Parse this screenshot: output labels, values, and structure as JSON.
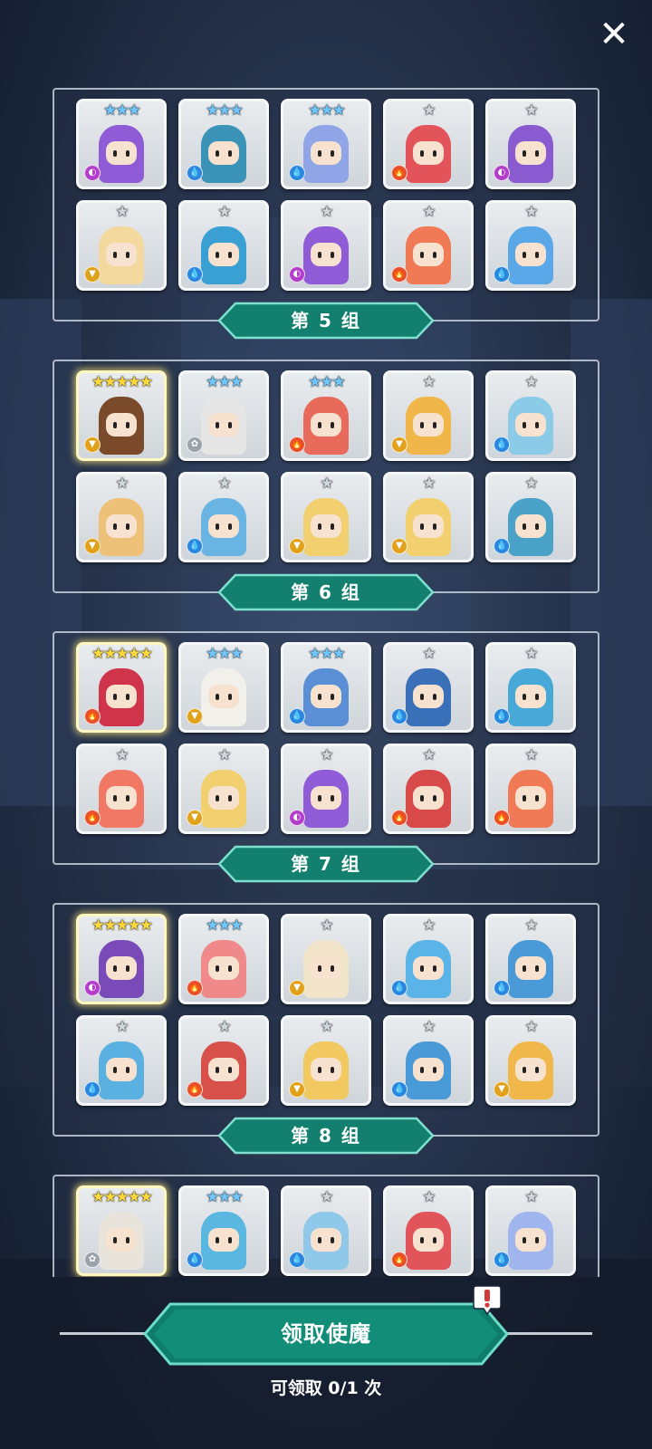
{
  "close_label": "✕",
  "groups": [
    {
      "label": "第 5 组",
      "cards": [
        {
          "stars": "★★★",
          "tier": 3,
          "element": "dark",
          "body": "#8f5bd6"
        },
        {
          "stars": "★★★",
          "tier": 3,
          "element": "water",
          "body": "#3b93b8"
        },
        {
          "stars": "★★★",
          "tier": 3,
          "element": "water",
          "body": "#8fa5e8"
        },
        {
          "stars": "★",
          "tier": 1,
          "element": "fire",
          "body": "#e3545a"
        },
        {
          "stars": "★",
          "tier": 1,
          "element": "dark",
          "body": "#8a5ad0"
        },
        {
          "stars": "★",
          "tier": 1,
          "element": "earth",
          "body": "#f3d99e"
        },
        {
          "stars": "★",
          "tier": 1,
          "element": "water",
          "body": "#3aa0d4"
        },
        {
          "stars": "★",
          "tier": 1,
          "element": "dark",
          "body": "#8f5bd6"
        },
        {
          "stars": "★",
          "tier": 1,
          "element": "fire",
          "body": "#f07a55"
        },
        {
          "stars": "★",
          "tier": 1,
          "element": "water",
          "body": "#5aa8e8"
        }
      ]
    },
    {
      "label": "第 6 组",
      "cards": [
        {
          "stars": "★★★★★",
          "tier": 5,
          "element": "earth",
          "body": "#7a4a2a"
        },
        {
          "stars": "★★★",
          "tier": 3,
          "element": "light",
          "body": "#e6e6e6"
        },
        {
          "stars": "★★★",
          "tier": 3,
          "element": "fire",
          "body": "#e86a5a"
        },
        {
          "stars": "★",
          "tier": 1,
          "element": "earth",
          "body": "#f0b64a"
        },
        {
          "stars": "★",
          "tier": 1,
          "element": "water",
          "body": "#8ccbe8"
        },
        {
          "stars": "★",
          "tier": 1,
          "element": "earth",
          "body": "#eec178"
        },
        {
          "stars": "★",
          "tier": 1,
          "element": "water",
          "body": "#6ab4e4"
        },
        {
          "stars": "★",
          "tier": 1,
          "element": "earth",
          "body": "#f2d070"
        },
        {
          "stars": "★",
          "tier": 1,
          "element": "earth",
          "body": "#f2d070"
        },
        {
          "stars": "★",
          "tier": 1,
          "element": "water",
          "body": "#4aa2c8"
        }
      ]
    },
    {
      "label": "第 7 组",
      "cards": [
        {
          "stars": "★★★★★",
          "tier": 5,
          "element": "fire",
          "body": "#d0344a"
        },
        {
          "stars": "★★★",
          "tier": 3,
          "element": "earth",
          "body": "#f2f0ea"
        },
        {
          "stars": "★★★",
          "tier": 3,
          "element": "water",
          "body": "#5a8fd6"
        },
        {
          "stars": "★",
          "tier": 1,
          "element": "water",
          "body": "#3a70b8"
        },
        {
          "stars": "★",
          "tier": 1,
          "element": "water",
          "body": "#48a8d8"
        },
        {
          "stars": "★",
          "tier": 1,
          "element": "fire",
          "body": "#f27866"
        },
        {
          "stars": "★",
          "tier": 1,
          "element": "earth",
          "body": "#f2d070"
        },
        {
          "stars": "★",
          "tier": 1,
          "element": "dark",
          "body": "#8f5bd6"
        },
        {
          "stars": "★",
          "tier": 1,
          "element": "fire",
          "body": "#d84a4a"
        },
        {
          "stars": "★",
          "tier": 1,
          "element": "fire",
          "body": "#f07a55"
        }
      ]
    },
    {
      "label": "第 8 组",
      "cards": [
        {
          "stars": "★★★★★",
          "tier": 5,
          "element": "dark",
          "body": "#7a4ab8"
        },
        {
          "stars": "★★★",
          "tier": 3,
          "element": "fire",
          "body": "#f08a8a"
        },
        {
          "stars": "★",
          "tier": 1,
          "element": "earth",
          "body": "#f2e4c8"
        },
        {
          "stars": "★",
          "tier": 1,
          "element": "water",
          "body": "#5ab4e8"
        },
        {
          "stars": "★",
          "tier": 1,
          "element": "water",
          "body": "#4a9ad8"
        },
        {
          "stars": "★",
          "tier": 1,
          "element": "water",
          "body": "#5ab0e0"
        },
        {
          "stars": "★",
          "tier": 1,
          "element": "fire",
          "body": "#d8504a"
        },
        {
          "stars": "★",
          "tier": 1,
          "element": "earth",
          "body": "#f2c860"
        },
        {
          "stars": "★",
          "tier": 1,
          "element": "water",
          "body": "#4a9ad8"
        },
        {
          "stars": "★",
          "tier": 1,
          "element": "earth",
          "body": "#f0b84a"
        }
      ]
    },
    {
      "label": "",
      "cards": [
        {
          "stars": "★★★★★",
          "tier": 5,
          "element": "light",
          "body": "#e8e4dc"
        },
        {
          "stars": "★★★",
          "tier": 3,
          "element": "water",
          "body": "#5ab8e0"
        },
        {
          "stars": "★",
          "tier": 1,
          "element": "water",
          "body": "#8fc8e8"
        },
        {
          "stars": "★",
          "tier": 1,
          "element": "fire",
          "body": "#e0545a"
        },
        {
          "stars": "★",
          "tier": 1,
          "element": "water",
          "body": "#a0b4ee"
        }
      ]
    }
  ],
  "element_icons": {
    "water": "💧",
    "fire": "🔥",
    "dark": "◐",
    "earth": "▼",
    "light": "✿"
  },
  "colors": {
    "ribbon": "#13806f",
    "ribbon_border": "#7fe0cf",
    "card_bg": "#dfe3e7"
  },
  "claim_button": {
    "label": "领取使魔"
  },
  "remaining_text": "可领取 0/1 次"
}
